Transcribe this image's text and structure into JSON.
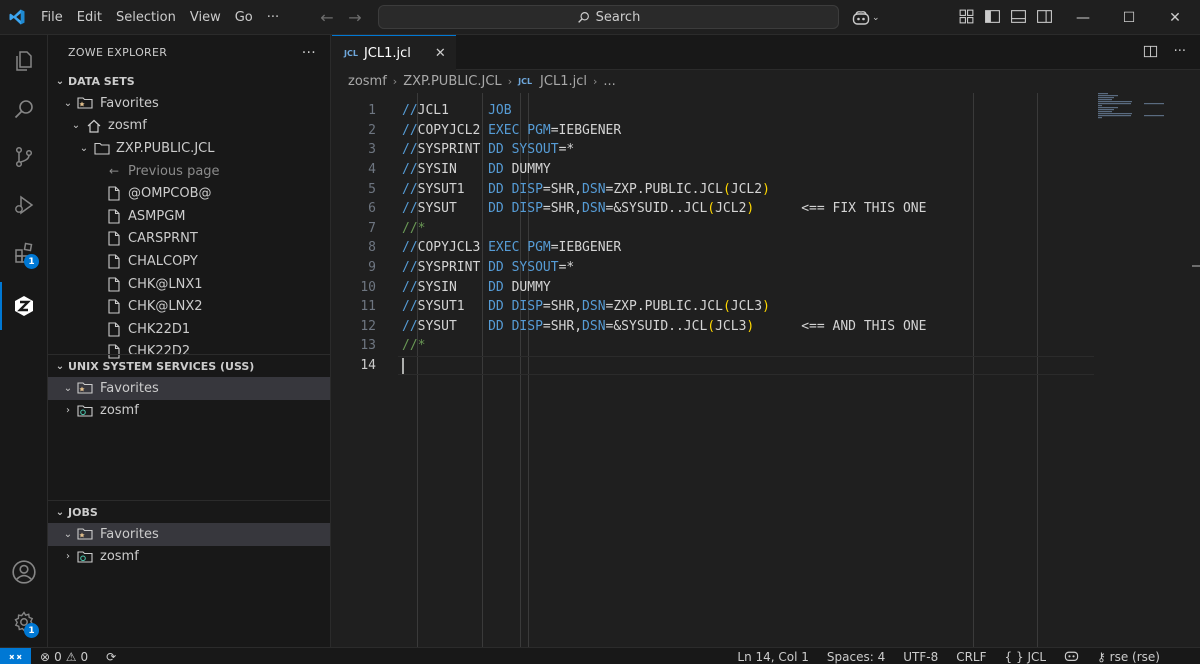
{
  "titlebar": {
    "menu": [
      "File",
      "Edit",
      "Selection",
      "View",
      "Go"
    ],
    "more": "···",
    "search_label": "Search",
    "window_buttons": [
      "—",
      "☐",
      "✕"
    ]
  },
  "activitybar": {
    "extensions_badge": "1",
    "settings_badge": "1"
  },
  "sidebar": {
    "title": "ZOWE EXPLORER",
    "more": "···",
    "datasets": {
      "header": "DATA SETS",
      "favorites": "Favorites",
      "profile": "zosmf",
      "dataset": "ZXP.PUBLIC.JCL",
      "previous": "Previous page",
      "members": [
        "@OMPCOB@",
        "ASMPGM",
        "CARSPRNT",
        "CHALCOPY",
        "CHK@LNX1",
        "CHK@LNX2",
        "CHK22D1",
        "CHK22D2"
      ]
    },
    "uss": {
      "header": "UNIX SYSTEM SERVICES (USS)",
      "favorites": "Favorites",
      "profile": "zosmf"
    },
    "jobs": {
      "header": "JOBS",
      "favorites": "Favorites",
      "profile": "zosmf"
    }
  },
  "editor": {
    "tab": {
      "icon_text": "JCL",
      "label": "JCL1.jcl"
    },
    "breadcrumb": [
      "zosmf",
      "ZXP.PUBLIC.JCL",
      "JCL1.jcl",
      "..."
    ],
    "breadcrumb_icon_text": "JCL",
    "line_numbers": [
      "1",
      "2",
      "3",
      "4",
      "5",
      "6",
      "7",
      "8",
      "9",
      "10",
      "11",
      "12",
      "13",
      "14"
    ],
    "lines": [
      [
        [
          "s",
          "//"
        ],
        [
          "n",
          "JCL1     "
        ],
        [
          "k",
          "JOB"
        ]
      ],
      [
        [
          "s",
          "//"
        ],
        [
          "n",
          "COPYJCL2 "
        ],
        [
          "k",
          "EXEC "
        ],
        [
          "k",
          "PGM"
        ],
        [
          "n",
          "=IEBGENER"
        ]
      ],
      [
        [
          "s",
          "//"
        ],
        [
          "n",
          "SYSPRINT "
        ],
        [
          "k",
          "DD "
        ],
        [
          "k",
          "SYSOUT"
        ],
        [
          "n",
          "=*"
        ]
      ],
      [
        [
          "s",
          "//"
        ],
        [
          "n",
          "SYSIN    "
        ],
        [
          "k",
          "DD "
        ],
        [
          "n",
          "DUMMY"
        ]
      ],
      [
        [
          "s",
          "//"
        ],
        [
          "n",
          "SYSUT1   "
        ],
        [
          "k",
          "DD "
        ],
        [
          "k",
          "DISP"
        ],
        [
          "n",
          "=SHR,"
        ],
        [
          "k",
          "DSN"
        ],
        [
          "n",
          "=ZXP.PUBLIC.JCL"
        ],
        [
          "p",
          "("
        ],
        [
          "n",
          "JCL2"
        ],
        [
          "p",
          ")"
        ]
      ],
      [
        [
          "s",
          "//"
        ],
        [
          "n",
          "SYSUT    "
        ],
        [
          "k",
          "DD "
        ],
        [
          "k",
          "DISP"
        ],
        [
          "n",
          "=SHR,"
        ],
        [
          "k",
          "DSN"
        ],
        [
          "n",
          "=&SYSUID..JCL"
        ],
        [
          "p",
          "("
        ],
        [
          "n",
          "JCL2"
        ],
        [
          "p",
          ")"
        ],
        [
          "n",
          "      <== FIX THIS ONE"
        ]
      ],
      [
        [
          "c",
          "//*"
        ]
      ],
      [
        [
          "s",
          "//"
        ],
        [
          "n",
          "COPYJCL3 "
        ],
        [
          "k",
          "EXEC "
        ],
        [
          "k",
          "PGM"
        ],
        [
          "n",
          "=IEBGENER"
        ]
      ],
      [
        [
          "s",
          "//"
        ],
        [
          "n",
          "SYSPRINT "
        ],
        [
          "k",
          "DD "
        ],
        [
          "k",
          "SYSOUT"
        ],
        [
          "n",
          "=*"
        ]
      ],
      [
        [
          "s",
          "//"
        ],
        [
          "n",
          "SYSIN    "
        ],
        [
          "k",
          "DD "
        ],
        [
          "n",
          "DUMMY"
        ]
      ],
      [
        [
          "s",
          "//"
        ],
        [
          "n",
          "SYSUT1   "
        ],
        [
          "k",
          "DD "
        ],
        [
          "k",
          "DISP"
        ],
        [
          "n",
          "=SHR,"
        ],
        [
          "k",
          "DSN"
        ],
        [
          "n",
          "=ZXP.PUBLIC.JCL"
        ],
        [
          "p",
          "("
        ],
        [
          "n",
          "JCL3"
        ],
        [
          "p",
          ")"
        ]
      ],
      [
        [
          "s",
          "//"
        ],
        [
          "n",
          "SYSUT    "
        ],
        [
          "k",
          "DD "
        ],
        [
          "k",
          "DISP"
        ],
        [
          "n",
          "=SHR,"
        ],
        [
          "k",
          "DSN"
        ],
        [
          "n",
          "=&SYSUID..JCL"
        ],
        [
          "p",
          "("
        ],
        [
          "n",
          "JCL3"
        ],
        [
          "p",
          ")"
        ],
        [
          "n",
          "      <== AND THIS ONE"
        ]
      ],
      [
        [
          "c",
          "//*"
        ]
      ],
      []
    ]
  },
  "statusbar": {
    "errors": "0",
    "warnings": "0",
    "position": "Ln 14, Col 1",
    "spaces": "Spaces: 4",
    "encoding": "UTF-8",
    "eol": "CRLF",
    "language": "JCL",
    "language_icon": "{ }",
    "profile": "rse (rse)"
  },
  "colors": {
    "accent": "#0078d4",
    "keyword": "#569cd6",
    "paren": "#ffd700",
    "comment": "#6a9955"
  }
}
